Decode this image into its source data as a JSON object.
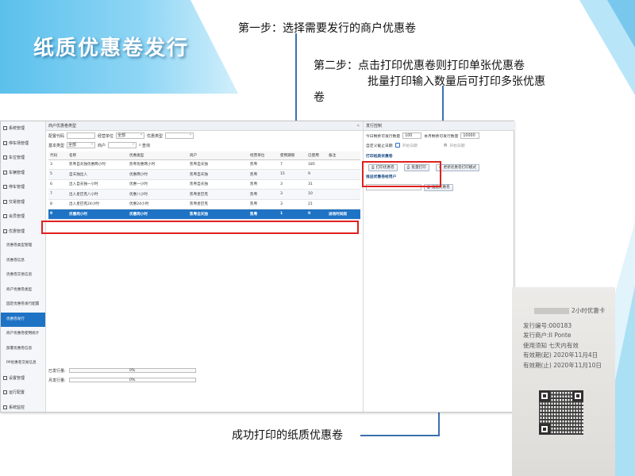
{
  "slide": {
    "title": "纸质优惠卷发行",
    "step1": "第一步：选择需要发行的商户优惠卷",
    "step2_line1": "第二步：点击打印优惠卷则打印单张优惠卷",
    "step2_line2": "批量打印输入数量后可打印多张优惠",
    "step2_line3": "卷",
    "caption": "成功打印的纸质优惠卷",
    "accent": "#5bc0ec",
    "highlight": "#e02020",
    "selection": "#1f73c5"
  },
  "sidebar": {
    "items": [
      {
        "label": "系统管理",
        "icon": "gear-icon",
        "type": "top"
      },
      {
        "label": "停车场管理",
        "icon": "parking-icon",
        "type": "top"
      },
      {
        "label": "车位管理",
        "icon": "car-icon",
        "type": "top"
      },
      {
        "label": "车辆管理",
        "icon": "grid-icon",
        "type": "top"
      },
      {
        "label": "停车管理",
        "icon": "car-icon",
        "type": "top"
      },
      {
        "label": "交易管理",
        "icon": "card-icon",
        "type": "top"
      },
      {
        "label": "会员管理",
        "icon": "user-icon",
        "type": "top"
      },
      {
        "label": "优惠管理",
        "icon": "tag-icon",
        "type": "top"
      },
      {
        "label": "优惠卷类型管理",
        "type": "sub"
      },
      {
        "label": "优惠卷信息",
        "type": "sub"
      },
      {
        "label": "优惠卷交易信息",
        "type": "sub"
      },
      {
        "label": "商户优惠卷类型",
        "type": "sub"
      },
      {
        "label": "固定优惠卷发行配置",
        "type": "sub"
      },
      {
        "label": "优惠卷发行",
        "type": "sub",
        "active": true
      },
      {
        "label": "商户优惠卷使用统计",
        "type": "sub"
      },
      {
        "label": "部署优惠卷信息",
        "type": "sub"
      },
      {
        "label": "PP优惠卷交易信息",
        "type": "sub"
      },
      {
        "label": "设置管理",
        "icon": "gear-icon",
        "type": "top"
      },
      {
        "label": "运行配置",
        "icon": "gear-icon",
        "type": "top"
      },
      {
        "label": "系统监控",
        "icon": "plus-icon",
        "type": "top"
      }
    ]
  },
  "left_panel": {
    "title": "商户优惠卷类型",
    "filters": {
      "code_label": "配置代码",
      "operator_label": "经营单位",
      "operator_value": "全部",
      "coupon_type_label": "优惠类型",
      "base_type_label": "基本类型",
      "base_type_value": "全部",
      "merchant_label": "商户",
      "search_label": "查询"
    },
    "table": {
      "headers": [
        "代码",
        "名称",
        "优惠类型",
        "商户",
        "经营单位",
        "使用期限",
        "已使用",
        "备注"
      ],
      "rows": [
        [
          "3",
          "凯粤自天独优惠两小时",
          "凯粤优惠两小时",
          "凯粤自天独",
          "凯粤",
          "7",
          "185",
          ""
        ],
        [
          "5",
          "自天独出入",
          "优惠两小时",
          "凯粤自天独",
          "凯粤",
          "15",
          "9",
          ""
        ],
        [
          "6",
          "出入自天独一小时",
          "优惠一小时",
          "凯粤自天独",
          "凯粤",
          "3",
          "31",
          ""
        ],
        [
          "7",
          "出入星巴克八小时",
          "优惠八小时",
          "凯粤星巴克",
          "凯粤",
          "3",
          "10",
          ""
        ],
        [
          "8",
          "出入星巴克24小时",
          "优惠24小时",
          "凯粤星巴克",
          "凯粤",
          "3",
          "21",
          ""
        ],
        [
          "9",
          "优惠两小时",
          "优惠两小时",
          "凯粤自天独",
          "凯粤",
          "1",
          "0",
          "进场时间超"
        ]
      ],
      "selected_index": 5
    },
    "progress": [
      {
        "label": "已发行量:",
        "text": "0%",
        "value": 0
      },
      {
        "label": "月发行量:",
        "text": "0%",
        "value": 0
      }
    ]
  },
  "right_panel": {
    "title": "发行控制",
    "today_limit_label": "今日剩余可发行数量",
    "today_limit_value": "100",
    "month_limit_label": "本月剩余可发行数量",
    "month_limit_value": "10000",
    "custom_date_label": "自定义截止日期",
    "start_date_label": "开始日期",
    "end_date_label": "开始日期",
    "print_section_label": "打印纸质优惠卷",
    "print_button": "打印优惠卷",
    "batch_print_button": "批量打印",
    "update_button": "更新优惠卷打印模式",
    "send_section_label": "推送优惠卷给用户",
    "send_button": "推送优惠卷"
  },
  "coupon": {
    "title": "2小时优惠卡",
    "lines": [
      "发行编号:000183",
      "发行商户:II Ponte",
      "使用须知 七天内有效",
      "有效期(起) 2020年11月4日",
      "有效期(止) 2020年11月10日"
    ]
  }
}
